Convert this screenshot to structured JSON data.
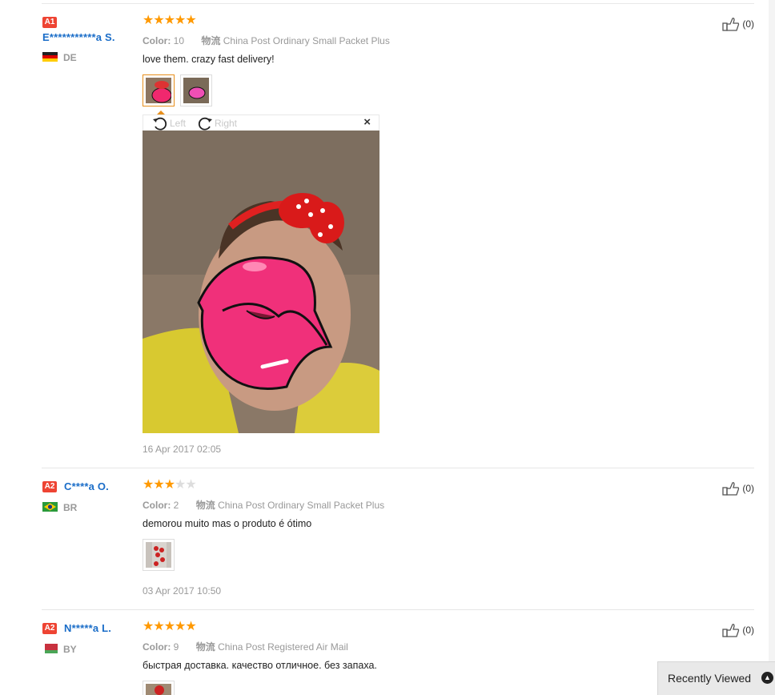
{
  "reviews": [
    {
      "level": "A1",
      "user": "E***********a S.",
      "country": "DE",
      "rating": 5,
      "color_label": "Color:",
      "color_value": "10",
      "shipping_label": "物流",
      "shipping_value": "China Post Ordinary Small Packet Plus",
      "text": "love them. crazy fast delivery!",
      "date": "16 Apr 2017 02:05",
      "likes": "(0)"
    },
    {
      "level": "A2",
      "user": "C****a O.",
      "country": "BR",
      "rating": 3,
      "color_label": "Color:",
      "color_value": "2",
      "shipping_label": "物流",
      "shipping_value": "China Post Ordinary Small Packet Plus",
      "text": "demorou muito mas o produto é ótimo",
      "date": "03 Apr 2017 10:50",
      "likes": "(0)"
    },
    {
      "level": "A2",
      "user": "N*****a L.",
      "country": "BY",
      "rating": 5,
      "color_label": "Color:",
      "color_value": "9",
      "shipping_label": "物流",
      "shipping_value": "China Post Registered Air Mail",
      "text": "быстрая доставка. качество отличное. без запаха.",
      "likes": "(0)"
    }
  ],
  "viewer": {
    "rotate_left": "Left",
    "rotate_right": "Right",
    "close": "×"
  },
  "recently_viewed": "Recently Viewed",
  "colors": {
    "username": "#1a6dc8",
    "star": "#ff9900",
    "level_badge": "#ee4433",
    "selected_thumb": "#e78f1c"
  }
}
